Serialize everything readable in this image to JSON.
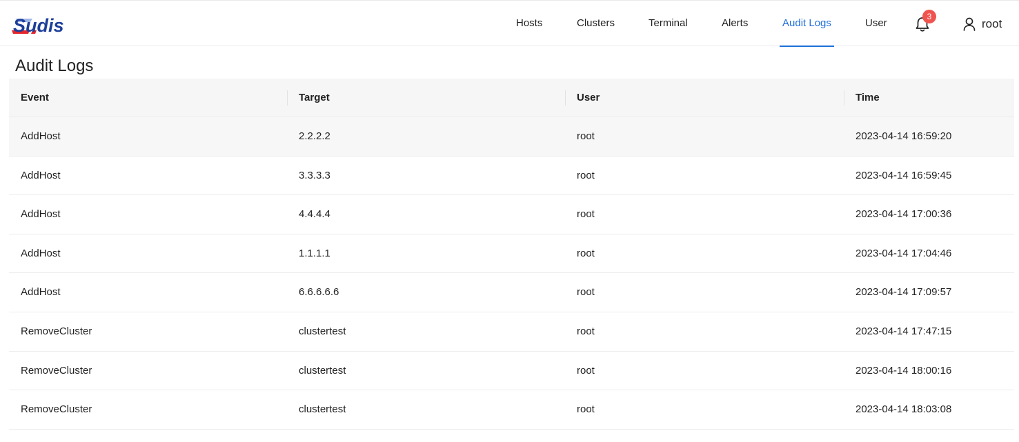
{
  "brand": {
    "logo_text": "Sudis"
  },
  "nav": [
    {
      "label": "Hosts",
      "active": false
    },
    {
      "label": "Clusters",
      "active": false
    },
    {
      "label": "Terminal",
      "active": false
    },
    {
      "label": "Alerts",
      "active": false
    },
    {
      "label": "Audit Logs",
      "active": true
    },
    {
      "label": "User",
      "active": false
    }
  ],
  "notifications": {
    "icon": "bell-icon",
    "count": "3"
  },
  "account": {
    "icon": "user-icon",
    "name": "root"
  },
  "page": {
    "title": "Audit Logs"
  },
  "table": {
    "columns": [
      "Event",
      "Target",
      "User",
      "Time"
    ],
    "rows": [
      [
        "AddHost",
        "2.2.2.2",
        "root",
        "2023-04-14 16:59:20"
      ],
      [
        "AddHost",
        "3.3.3.3",
        "root",
        "2023-04-14 16:59:45"
      ],
      [
        "AddHost",
        "4.4.4.4",
        "root",
        "2023-04-14 17:00:36"
      ],
      [
        "AddHost",
        "1.1.1.1",
        "root",
        "2023-04-14 17:04:46"
      ],
      [
        "AddHost",
        "6.6.6.6.6",
        "root",
        "2023-04-14 17:09:57"
      ],
      [
        "RemoveCluster",
        "clustertest",
        "root",
        "2023-04-14 17:47:15"
      ],
      [
        "RemoveCluster",
        "clustertest",
        "root",
        "2023-04-14 18:00:16"
      ],
      [
        "RemoveCluster",
        "clustertest",
        "root",
        "2023-04-14 18:03:08"
      ]
    ]
  },
  "colors": {
    "accent": "#1e6fd9",
    "badge": "#f0544f",
    "logo_blue": "#1d3f9a",
    "logo_red": "#e3262b"
  }
}
